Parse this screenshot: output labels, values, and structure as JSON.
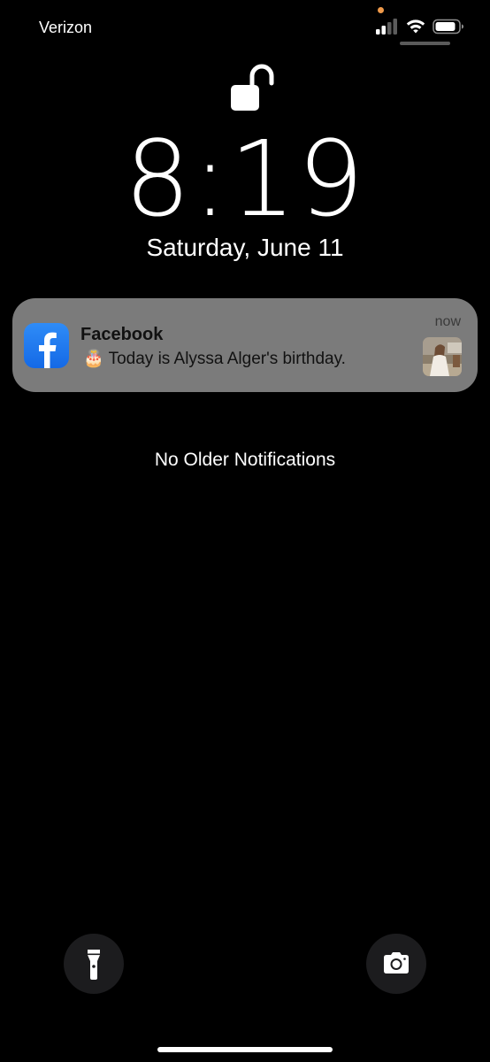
{
  "status_bar": {
    "carrier": "Verizon",
    "signal_bars_active": 2,
    "signal_bars_total": 4,
    "wifi": "wifi-icon",
    "battery": "battery-icon",
    "mic_indicator_color": "#f09a4a"
  },
  "lock_screen": {
    "lock_icon": "unlocked-padlock-icon",
    "time": "8:19",
    "date": "Saturday, June 11"
  },
  "notification": {
    "app_name": "Facebook",
    "time": "now",
    "emoji": "🎂",
    "message": "Today is Alyssa Alger's birthday.",
    "app_icon": "facebook-icon",
    "app_icon_color": "#1877f2",
    "thumbnail": "person-photo-thumbnail"
  },
  "notification_center": {
    "empty_text": "No Older Notifications"
  },
  "quick_actions": {
    "flashlight": "flashlight-icon",
    "camera": "camera-icon"
  }
}
